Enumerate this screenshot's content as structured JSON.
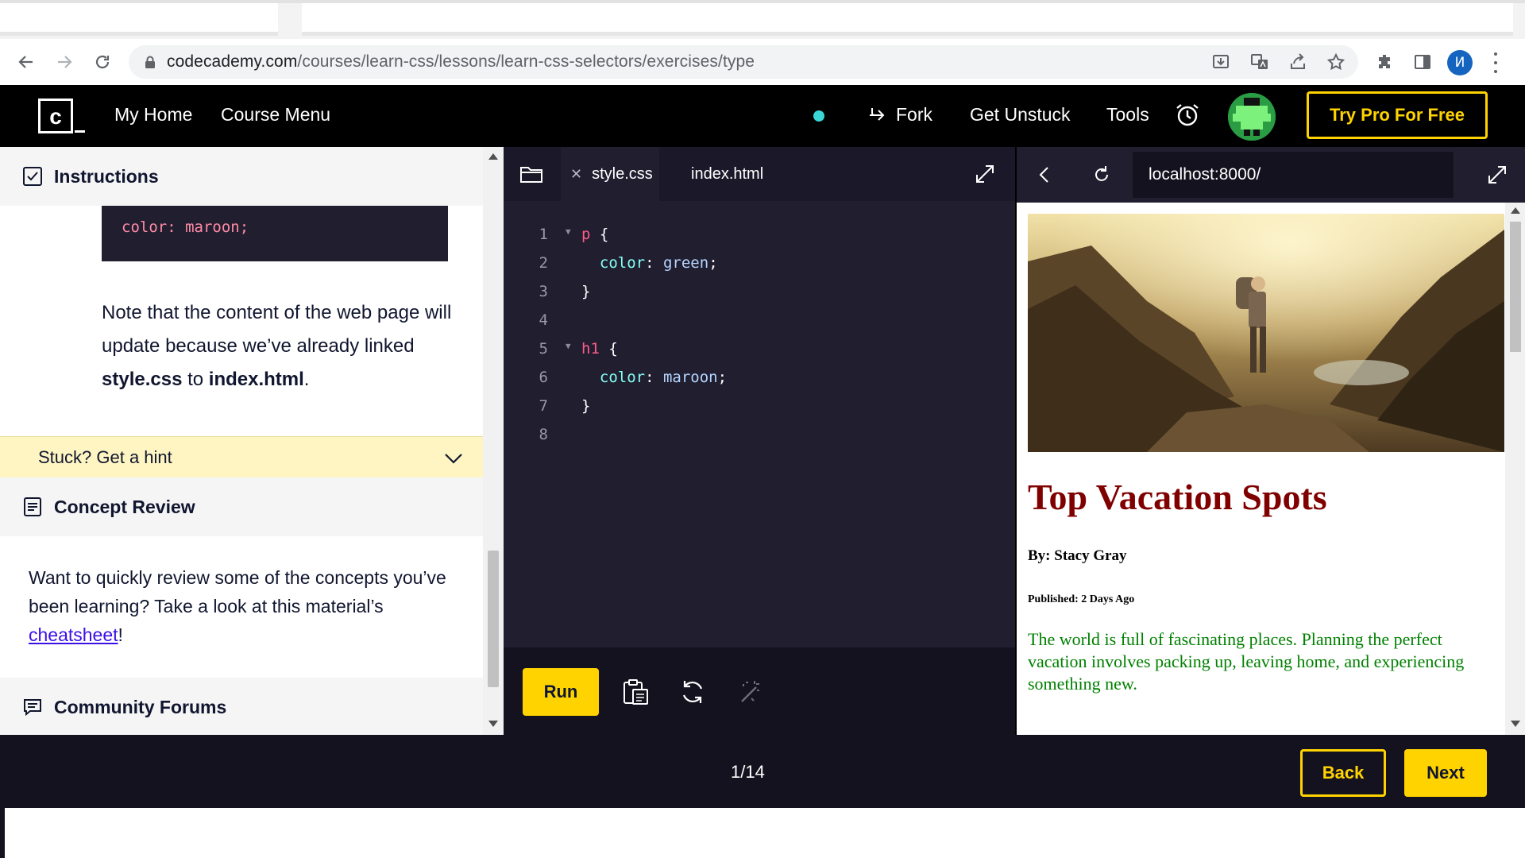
{
  "browser": {
    "url_host": "codecademy.com",
    "url_path": "/courses/learn-css/lessons/learn-css-selectors/exercises/type",
    "profile_initial": "И"
  },
  "header": {
    "nav": [
      "My Home",
      "Course Menu"
    ],
    "fork_label": "Fork",
    "get_unstuck_label": "Get Unstuck",
    "tools_label": "Tools",
    "try_pro_label": "Try Pro For Free",
    "accent": "#ffd300"
  },
  "instructions": {
    "title": "Instructions",
    "code_snippet": "color: maroon;",
    "note_prefix": "Note that the content of the web page will update because we’ve already linked ",
    "note_file1": "style.css",
    "note_mid": " to ",
    "note_file2": "index.html",
    "note_suffix": ".",
    "hint_label": "Stuck? Get a hint"
  },
  "concept_review": {
    "title": "Concept Review",
    "text": "Want to quickly review some of the concepts you’ve been learning? Take a look at this material’s ",
    "link": "cheatsheet",
    "suffix": "!"
  },
  "community": {
    "title": "Community Forums"
  },
  "editor": {
    "tabs": [
      "style.css",
      "index.html"
    ],
    "active_tab": "style.css",
    "lines": [
      {
        "n": "1",
        "fold": true,
        "sel": "p",
        "rest": " {"
      },
      {
        "n": "2",
        "prop": "color",
        "val": "green"
      },
      {
        "n": "3",
        "close": "}"
      },
      {
        "n": "4"
      },
      {
        "n": "5",
        "fold": true,
        "sel": "h1",
        "rest": " {"
      },
      {
        "n": "6",
        "prop": "color",
        "val": "maroon"
      },
      {
        "n": "7",
        "close": "}"
      },
      {
        "n": "8"
      }
    ],
    "run_label": "Run"
  },
  "preview": {
    "url": "localhost:8000/",
    "heading": "Top Vacation Spots",
    "byline": "By: Stacy Gray",
    "published": "Published: 2 Days Ago",
    "paragraph": "The world is full of fascinating places. Planning the perfect vacation involves packing up, leaving home, and experiencing something new."
  },
  "footer": {
    "pager": "1/14",
    "back_label": "Back",
    "next_label": "Next"
  }
}
